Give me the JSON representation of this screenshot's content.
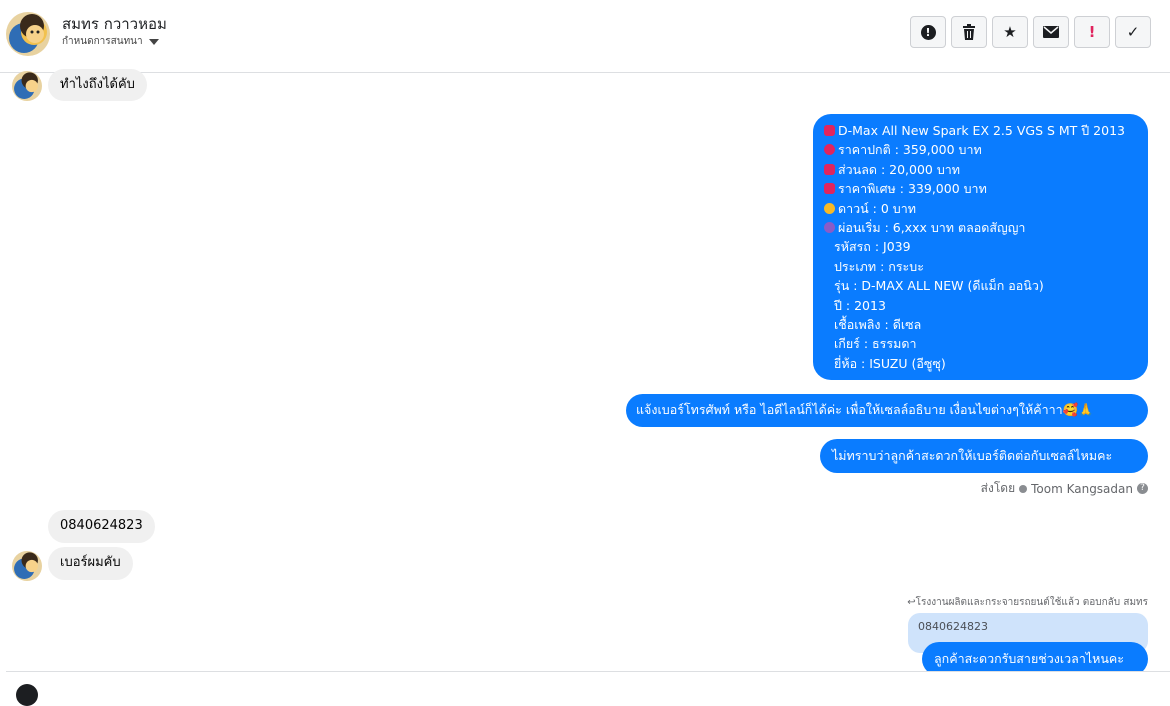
{
  "header": {
    "contact_name": "สมทร กวาวหอม",
    "assign_label": "กำหนดการสนทนา",
    "tools": [
      {
        "icon": "alert-circle-icon",
        "glyph": "!"
      },
      {
        "icon": "trash-icon",
        "glyph": "🗑"
      },
      {
        "icon": "star-icon",
        "glyph": "★"
      },
      {
        "icon": "envelope-icon",
        "glyph": "✉"
      },
      {
        "icon": "exclamation-icon",
        "glyph": "!"
      },
      {
        "icon": "check-icon",
        "glyph": "✓"
      }
    ]
  },
  "messages": {
    "in_1": "ทำไงถึงได้คับ",
    "car_lines": [
      "D-Max All New Spark EX 2.5 VGS S MT ปี 2013",
      "ราคาปกติ : 359,000 บาท",
      "ส่วนลด : 20,000 บาท",
      "ราคาพิเศษ : 339,000 บาท",
      "ดาวน์ : 0 บาท",
      "ผ่อนเริ่ม : 6,xxx บาท ตลอดสัญญา",
      "รหัสรถ : J039",
      "ประเภท : กระบะ",
      "รุ่น : D-MAX ALL NEW (ดีแม็ก ออนิว)",
      "ปี : 2013",
      "เชื้อเพลิง : ดีเซล",
      "เกียร์ : ธรรมดา",
      "ยี่ห้อ : ISUZU (อีซูซุ)"
    ],
    "out_2": "แจ้งเบอร์โทรศัพท์ หรือ ไอดีไลน์ก็ได้ค่ะ เพื่อให้เซลล์อธิบาย เงื่อนไขต่างๆให้ค้าาา🥰🙏",
    "out_3": "ไม่ทราบว่าลูกค้าสะดวกให้เบอร์ติดต่อกับเซลล์ไหมคะ",
    "sent_by_prefix": "ส่งโดย",
    "sent_by_name": "Toom Kangsadan",
    "in_2": "0840624823",
    "in_3": "เบอร์ผมคับ",
    "reply_note": "โรงงานผลิตและกระจายรถยนต์ใช้แล้ว ตอบกลับ สมทร",
    "quoted": "0840624823",
    "out_4": "ลูกค้าสะดวกรับสายช่วงเวลาไหนคะ"
  },
  "colors": {
    "outgoing_bubble": "#0a7cff",
    "incoming_bubble": "#f0f0f0",
    "quoted_bubble": "#cfe3fb",
    "emoji_car": "#e0245e",
    "emoji_star": "#f7b928",
    "emoji_pin": "#e0245e",
    "emoji_circle": "#8a5cc7"
  }
}
